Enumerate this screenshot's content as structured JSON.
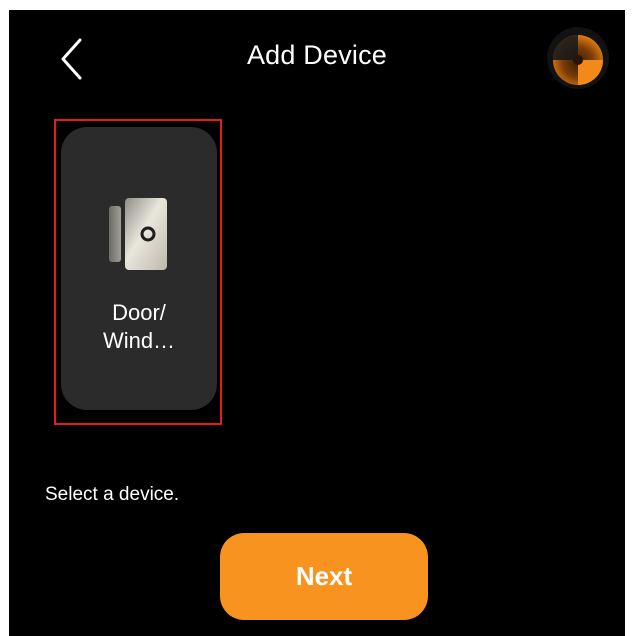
{
  "header": {
    "title": "Add Device",
    "back_icon": "chevron-left-icon",
    "avatar_icon": "loading-spinner-avatar"
  },
  "devices": [
    {
      "name": "Door/\nWind…",
      "icon": "door-window-sensor-icon",
      "selected": true
    }
  ],
  "hint_text": "Select a device.",
  "next_label": "Next",
  "colors": {
    "background": "#000000",
    "card": "#2b2b2b",
    "accent": "#f7931e",
    "selection_frame": "#e51c1c",
    "text": "#ffffff"
  }
}
